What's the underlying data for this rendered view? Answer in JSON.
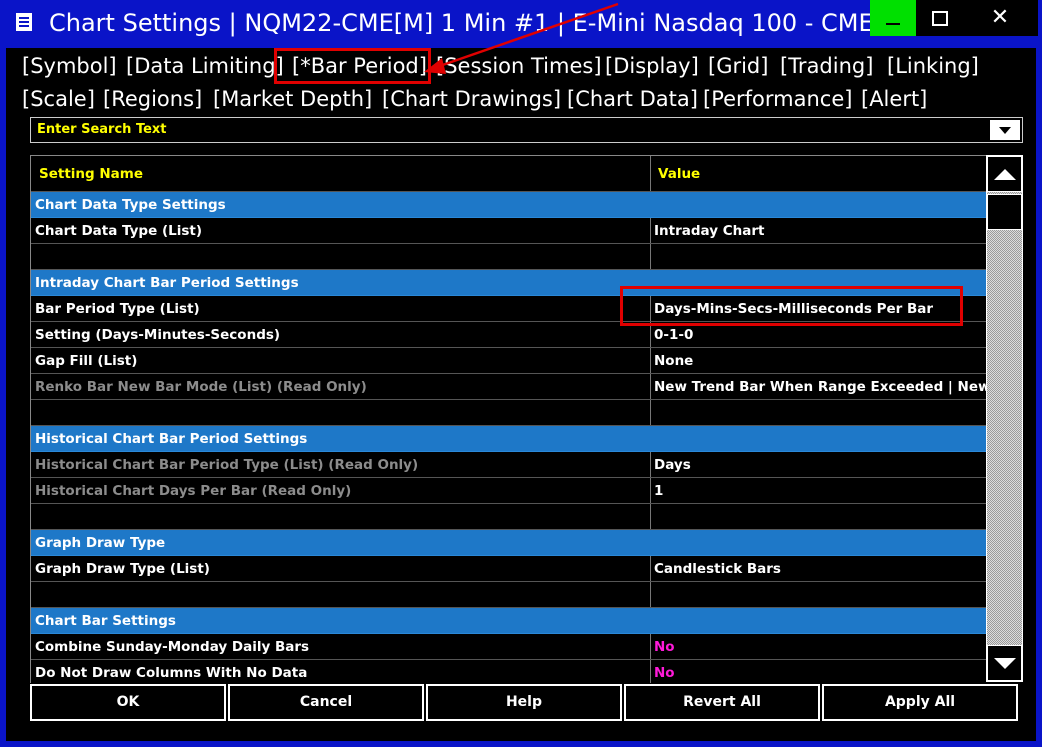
{
  "window": {
    "title": "Chart Settings | NQM22-CME[M]  1 Min   #1 | E-Mini Nasdaq 100 - CME",
    "close_glyph": "✕"
  },
  "tabs_row1": [
    "[Symbol]",
    "[Data Limiting]",
    "[*Bar Period]",
    "[Session Times]",
    "[Display]",
    "[Grid]",
    "[Trading]",
    "[Linking]"
  ],
  "tabs_row2": [
    "[Scale]",
    "[Regions]",
    "[Market Depth]",
    "[Chart Drawings]",
    "[Chart Data]",
    "[Performance]",
    "[Alert]"
  ],
  "search": {
    "placeholder": "Enter Search Text"
  },
  "table": {
    "header": {
      "name": "Setting Name",
      "value": "Value"
    },
    "rows": [
      {
        "type": "section",
        "name": "Chart Data Type Settings",
        "value": ""
      },
      {
        "type": "item",
        "name": "Chart Data Type (List)",
        "value": "Intraday Chart"
      },
      {
        "type": "blank",
        "name": "",
        "value": ""
      },
      {
        "type": "section",
        "name": "Intraday Chart Bar Period Settings",
        "value": ""
      },
      {
        "type": "item",
        "name": "Bar Period Type (List)",
        "value": "Days-Mins-Secs-Milliseconds Per Bar"
      },
      {
        "type": "item",
        "name": "Setting (Days-Minutes-Seconds)",
        "value": "0-1-0"
      },
      {
        "type": "item",
        "name": "Gap Fill (List)",
        "value": "None"
      },
      {
        "type": "readonly",
        "name": "Renko Bar New Bar Mode (List) (Read Only)",
        "value": "New Trend Bar When Range Exceeded | New Ba"
      },
      {
        "type": "blank",
        "name": "",
        "value": ""
      },
      {
        "type": "section",
        "name": "Historical Chart Bar Period Settings",
        "value": ""
      },
      {
        "type": "readonly",
        "name": "Historical Chart Bar Period Type (List) (Read Only)",
        "value": "Days"
      },
      {
        "type": "readonly",
        "name": "Historical Chart Days Per Bar (Read Only)",
        "value": "1"
      },
      {
        "type": "blank",
        "name": "",
        "value": ""
      },
      {
        "type": "section",
        "name": "Graph Draw Type",
        "value": ""
      },
      {
        "type": "item",
        "name": "Graph Draw Type (List)",
        "value": "Candlestick Bars"
      },
      {
        "type": "blank",
        "name": "",
        "value": ""
      },
      {
        "type": "section",
        "name": "Chart Bar Settings",
        "value": ""
      },
      {
        "type": "item-magenta",
        "name": "Combine Sunday-Monday Daily Bars",
        "value": "No"
      },
      {
        "type": "item-magenta",
        "name": "Do Not Draw Columns With No Data",
        "value": "No"
      }
    ]
  },
  "buttons": {
    "ok": "OK",
    "cancel": "Cancel",
    "help": "Help",
    "revert_all": "Revert All",
    "apply_all": "Apply All"
  },
  "colors": {
    "titlebar": "#0a14c8",
    "section": "#1e78c8",
    "header_text": "#ffff00",
    "highlight": "#e00000",
    "bool_value": "#ff1ad9"
  }
}
